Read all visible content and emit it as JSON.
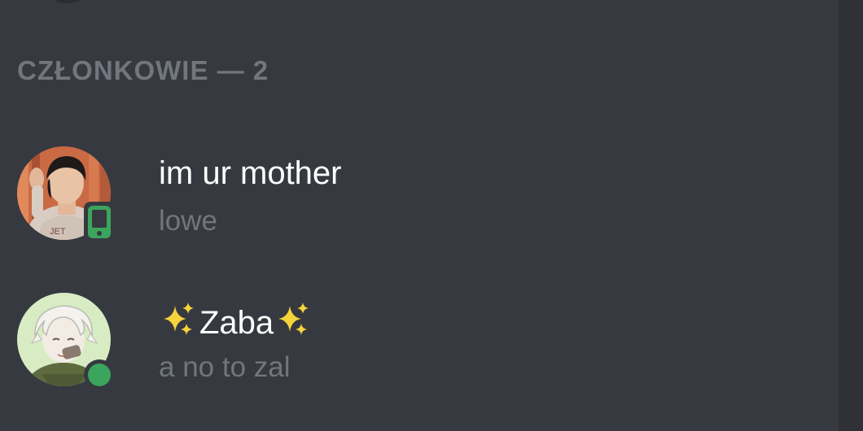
{
  "member_list": {
    "section_header": "CZŁONKOWIE — 2",
    "members": [
      {
        "display_name": "im ur mother",
        "custom_status": "lowe",
        "presence": "mobile-online",
        "avatar": "avatar-photo-icon"
      },
      {
        "display_name_prefix": "✨",
        "display_name": "Zaba",
        "display_name_suffix": "✨",
        "custom_status": "a no to zal",
        "presence": "online",
        "avatar": "avatar-anime-icon"
      }
    ]
  },
  "colors": {
    "background": "#36393f",
    "gutter": "#2f3136",
    "header_text": "#72767d",
    "name_text": "#ffffff",
    "status_text": "#72767d",
    "online_green": "#3ba55d",
    "sparkle_yellow": "#f5d33b"
  }
}
